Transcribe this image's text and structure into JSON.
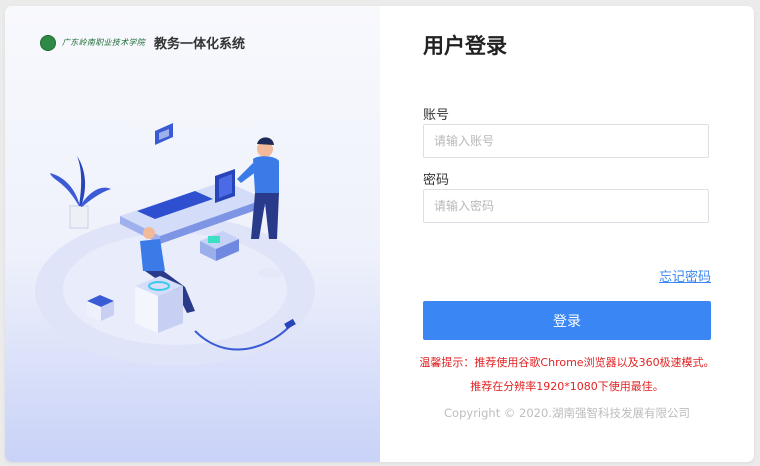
{
  "brand": {
    "school_name": "广东岭南职业技术学院",
    "system_name": "教务一体化系统"
  },
  "login": {
    "title": "用户登录",
    "account_label": "账号",
    "account_placeholder": "请输入账号",
    "account_value": "",
    "password_label": "密码",
    "password_placeholder": "请输入密码",
    "password_value": "",
    "forgot_link": "忘记密码",
    "login_button": "登录"
  },
  "tips": {
    "line1": "温馨提示：推荐使用谷歌Chrome浏览器以及360极速模式。",
    "line2": "推荐在分辨率1920*1080下使用最佳。"
  },
  "footer": {
    "copyright": "Copyright © 2020.湖南强智科技发展有限公司"
  },
  "colors": {
    "primary": "#3a86f4",
    "tip_red": "#e22323",
    "logo_green": "#2f8a46"
  },
  "icons": {
    "school_logo": "school-emblem-icon"
  }
}
